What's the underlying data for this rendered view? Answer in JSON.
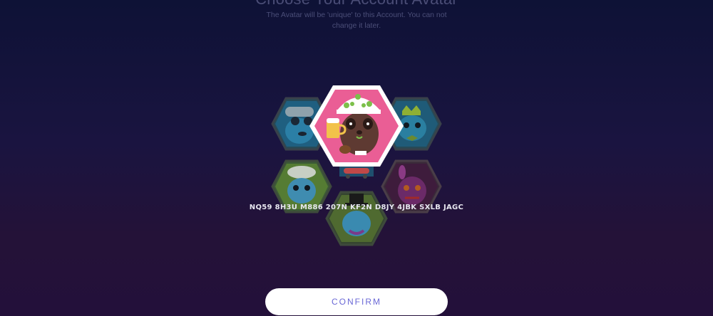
{
  "header": {
    "title": "Choose Your Account Avatar",
    "subtitle": "The Avatar will be 'unique' to this Account. You can not change it later."
  },
  "avatars": [
    {
      "name": "aviator-avatar",
      "bg": "#2c6a8e",
      "selected": false
    },
    {
      "name": "king-avatar",
      "bg": "#2a6a8c",
      "selected": false
    },
    {
      "name": "chef-avatar",
      "bg": "#5a8e3a",
      "selected": false
    },
    {
      "name": "purple-creature-avatar",
      "bg": "#4a2348",
      "selected": false
    },
    {
      "name": "top-hat-avatar",
      "bg": "#4a6a36",
      "selected": false
    },
    {
      "name": "beer-panda-avatar",
      "bg": "#e95e94",
      "selected": true
    }
  ],
  "account": {
    "id": "NQ59 8H3U M886 207N KF2N D8JY 4JBK SXLB JAGC"
  },
  "actions": {
    "confirm_label": "CONFIRM"
  }
}
